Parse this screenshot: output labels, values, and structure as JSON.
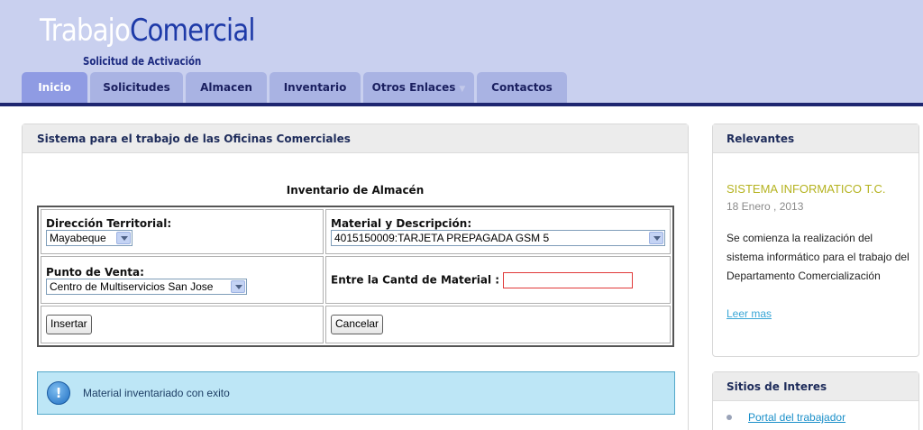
{
  "header": {
    "logo_part1": "Trabajo",
    "logo_part2": "Comercial",
    "subtitle": "Solicitud de Activación"
  },
  "nav": {
    "tabs": [
      {
        "label": "Inicio",
        "active": true
      },
      {
        "label": "Solicitudes"
      },
      {
        "label": "Almacen"
      },
      {
        "label": "Inventario"
      },
      {
        "label": "Otros Enlaces"
      },
      {
        "label": "Contactos"
      }
    ]
  },
  "main": {
    "panel_title": "Sistema para el trabajo de las Oficinas Comerciales",
    "form_title": "Inventario de Almacén",
    "direccion_label": "Dirección Territorial:",
    "direccion_value": "Mayabeque",
    "material_label": "Material y Descripción:",
    "material_value": "4015150009:TARJETA PREPAGADA GSM 5",
    "punto_label": "Punto de Venta:",
    "punto_value": "Centro de Multiservicios San Jose",
    "cantidad_label": "Entre la Cantd de Material :",
    "cantidad_value": "",
    "insert_button": "Insertar",
    "cancel_button": "Cancelar",
    "alert_icon_glyph": "!",
    "alert_message": "Material inventariado con exito"
  },
  "sidebar": {
    "relevantes_title": "Relevantes",
    "news_title": "SISTEMA INFORMATICO T.C.",
    "news_date": "18 Enero , 2013",
    "news_body": "Se comienza la realización del sistema informático para el trabajo del Departamento Comercialización",
    "read_more": "Leer mas",
    "sitios_title": "Sitios de Interes",
    "links": [
      "Portal del trabajador"
    ]
  },
  "colors": {
    "header_bg": "#c9d0ef",
    "header_line": "#1e2670",
    "tab_bg": "#a9b3e3",
    "tab_active_bg": "#8f9be3",
    "logo_accent": "#1e3aa8",
    "alert_bg": "#bde6f6",
    "news_title": "#b5b320",
    "link": "#1a8fc9"
  },
  "icons": {
    "alert": "info-alert-icon",
    "dropdown": "chevron-down-icon",
    "bullet": "bullet-icon"
  }
}
